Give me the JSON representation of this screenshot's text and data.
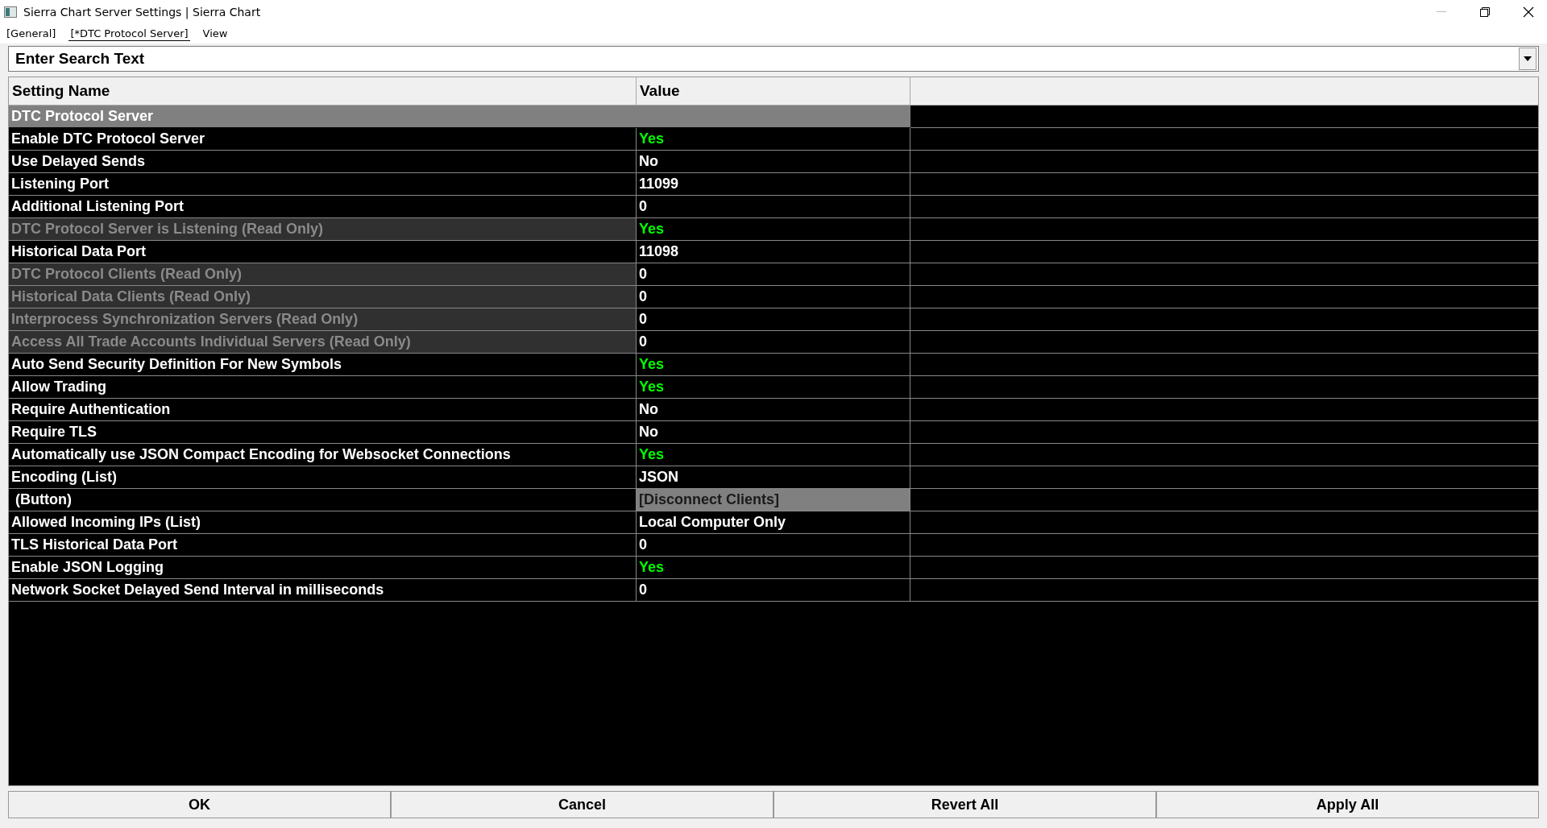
{
  "window": {
    "title": "Sierra Chart Server Settings | Sierra Chart"
  },
  "menu": [
    {
      "label": "[General]",
      "selected": false
    },
    {
      "label": "[*DTC Protocol Server]",
      "selected": true
    },
    {
      "label": "View",
      "selected": false
    }
  ],
  "search": {
    "placeholder": "Enter Search Text"
  },
  "table": {
    "columns": [
      "Setting Name",
      "Value"
    ],
    "rows": [
      {
        "kind": "section",
        "name": "DTC Protocol Server"
      },
      {
        "kind": "setting",
        "name": "Enable DTC Protocol Server",
        "value": "Yes",
        "on": true,
        "read_only": false
      },
      {
        "kind": "setting",
        "name": "Use Delayed Sends",
        "value": "No",
        "on": false,
        "read_only": false
      },
      {
        "kind": "setting",
        "name": "Listening Port",
        "value": "11099",
        "on": false,
        "read_only": false
      },
      {
        "kind": "setting",
        "name": "Additional Listening Port",
        "value": "0",
        "on": false,
        "read_only": false
      },
      {
        "kind": "setting",
        "name": "DTC Protocol Server is Listening (Read Only)",
        "value": "Yes",
        "on": true,
        "read_only": true
      },
      {
        "kind": "setting",
        "name": "Historical Data Port",
        "value": "11098",
        "on": false,
        "read_only": false
      },
      {
        "kind": "setting",
        "name": "DTC Protocol Clients (Read Only)",
        "value": "0",
        "on": false,
        "read_only": true
      },
      {
        "kind": "setting",
        "name": "Historical Data Clients (Read Only)",
        "value": "0",
        "on": false,
        "read_only": true
      },
      {
        "kind": "setting",
        "name": "Interprocess Synchronization Servers (Read Only)",
        "value": "0",
        "on": false,
        "read_only": true
      },
      {
        "kind": "setting",
        "name": "Access All Trade Accounts Individual Servers (Read Only)",
        "value": "0",
        "on": false,
        "read_only": true
      },
      {
        "kind": "setting",
        "name": "Auto Send Security Definition For New Symbols",
        "value": "Yes",
        "on": true,
        "read_only": false
      },
      {
        "kind": "setting",
        "name": "Allow Trading",
        "value": "Yes",
        "on": true,
        "read_only": false
      },
      {
        "kind": "setting",
        "name": "Require Authentication",
        "value": "No",
        "on": false,
        "read_only": false
      },
      {
        "kind": "setting",
        "name": "Require TLS",
        "value": "No",
        "on": false,
        "read_only": false
      },
      {
        "kind": "setting",
        "name": "Automatically use JSON Compact Encoding for Websocket Connections",
        "value": "Yes",
        "on": true,
        "read_only": false
      },
      {
        "kind": "setting",
        "name": "Encoding (List)",
        "value": "JSON",
        "on": false,
        "read_only": false
      },
      {
        "kind": "button",
        "name": " (Button)",
        "value": "[Disconnect Clients]"
      },
      {
        "kind": "setting",
        "name": "Allowed Incoming IPs (List)",
        "value": "Local Computer Only",
        "on": false,
        "read_only": false
      },
      {
        "kind": "setting",
        "name": "TLS Historical Data Port",
        "value": "0",
        "on": false,
        "read_only": false
      },
      {
        "kind": "setting",
        "name": "Enable JSON Logging",
        "value": "Yes",
        "on": true,
        "read_only": false
      },
      {
        "kind": "setting",
        "name": "Network Socket Delayed Send Interval in milliseconds",
        "value": "0",
        "on": false,
        "read_only": false
      }
    ]
  },
  "buttons": [
    "OK",
    "Cancel",
    "Revert All",
    "Apply All"
  ]
}
